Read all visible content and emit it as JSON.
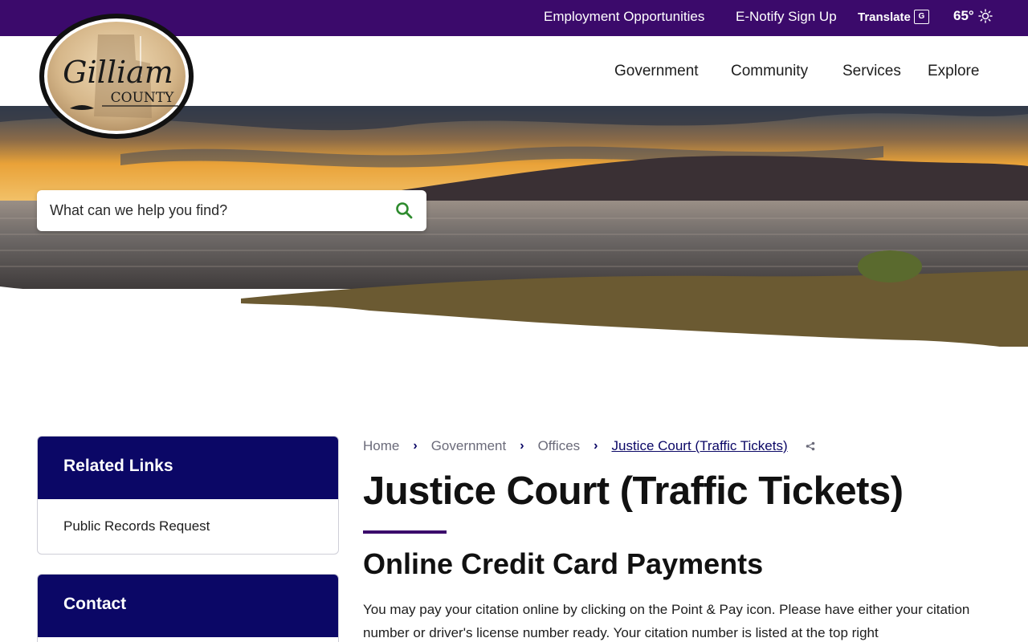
{
  "utility": {
    "employment": "Employment Opportunities",
    "enotify": "E-Notify Sign Up",
    "translate": "Translate",
    "temperature": "65°"
  },
  "logo": {
    "line1": "Gilliam",
    "line2": "COUNTY"
  },
  "nav": [
    "Government",
    "Community",
    "Services",
    "Explore"
  ],
  "search": {
    "placeholder": "What can we help you find?"
  },
  "sidebar": {
    "related_title": "Related Links",
    "related_items": [
      "Public Records Request"
    ],
    "contact_title": "Contact"
  },
  "breadcrumb": [
    "Home",
    "Government",
    "Offices",
    "Justice Court (Traffic Tickets)"
  ],
  "main": {
    "title": "Justice Court (Traffic Tickets)",
    "section_heading": "Online Credit Card Payments",
    "paragraph": "You may pay your citation online by clicking on the Point & Pay icon. Please have either your citation number or driver's license number ready. Your citation number is listed at the top right"
  },
  "colors": {
    "brand_purple": "#3b0a6b",
    "navy": "#0b0766",
    "search_green": "#2e8b2e"
  },
  "icons": [
    "translate-icon",
    "sun-icon",
    "search-icon",
    "chevron-right-icon",
    "share-icon"
  ]
}
